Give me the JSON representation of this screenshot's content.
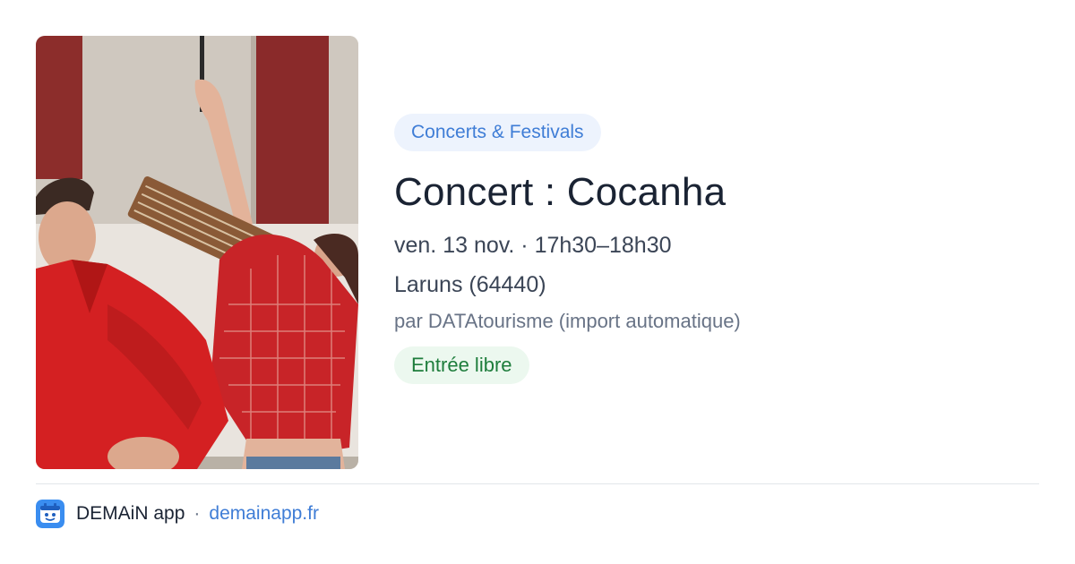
{
  "event": {
    "category": "Concerts & Festivals",
    "title": "Concert : Cocanha",
    "datetime": "ven. 13 nov. · 17h30–18h30",
    "location": "Laruns (64440)",
    "source": "par DATAtourisme (import automatique)",
    "price": "Entrée libre",
    "photo": "event-photo"
  },
  "footer": {
    "app_name": "DEMAiN app",
    "separator": "·",
    "site": "demainapp.fr",
    "logo": "demain-app-logo-icon"
  },
  "colors": {
    "accent_blue": "#3f7dd6",
    "category_chip_bg": "#edf3fd",
    "price_green": "#1e7d3c",
    "price_chip_bg": "#ecf8ef",
    "title_text": "#1a2333"
  }
}
